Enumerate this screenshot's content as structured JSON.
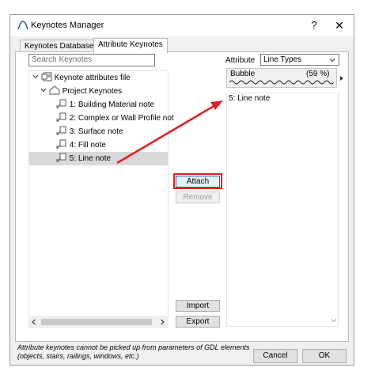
{
  "window": {
    "title": "Keynotes Manager",
    "help_label": "?",
    "close_label": "✕"
  },
  "tabs": [
    {
      "label": "Keynotes Database",
      "active": false
    },
    {
      "label": "Attribute Keynotes",
      "active": true
    }
  ],
  "search": {
    "placeholder": "Search Keynotes"
  },
  "tree": {
    "root": "Keynote attributes file",
    "folder": "Project Keynotes",
    "items": [
      {
        "label": "1: Building Material note"
      },
      {
        "label": "2: Complex or Wall Profile not"
      },
      {
        "label": "3: Surface note"
      },
      {
        "label": "4: Fill note"
      },
      {
        "label": "5: Line note",
        "selected": true
      }
    ]
  },
  "buttons": {
    "attach": "Attach",
    "remove": "Remove",
    "import": "Import",
    "export": "Export",
    "cancel": "Cancel",
    "ok": "OK"
  },
  "attribute": {
    "label": "Attribute",
    "selected": "Line Types"
  },
  "bubble": {
    "name": "Bubble",
    "percent": "(59 %)"
  },
  "right_list": {
    "items": [
      "5: Line note"
    ]
  },
  "footer": {
    "note": "Attribute keynotes cannot be picked up from parameters of GDL elements (objects, stairs, railings, windows, etc.)"
  },
  "colors": {
    "annotation_red": "#e02020",
    "focus_blue": "#0078d7",
    "selection_gray": "#d9d9d9"
  }
}
